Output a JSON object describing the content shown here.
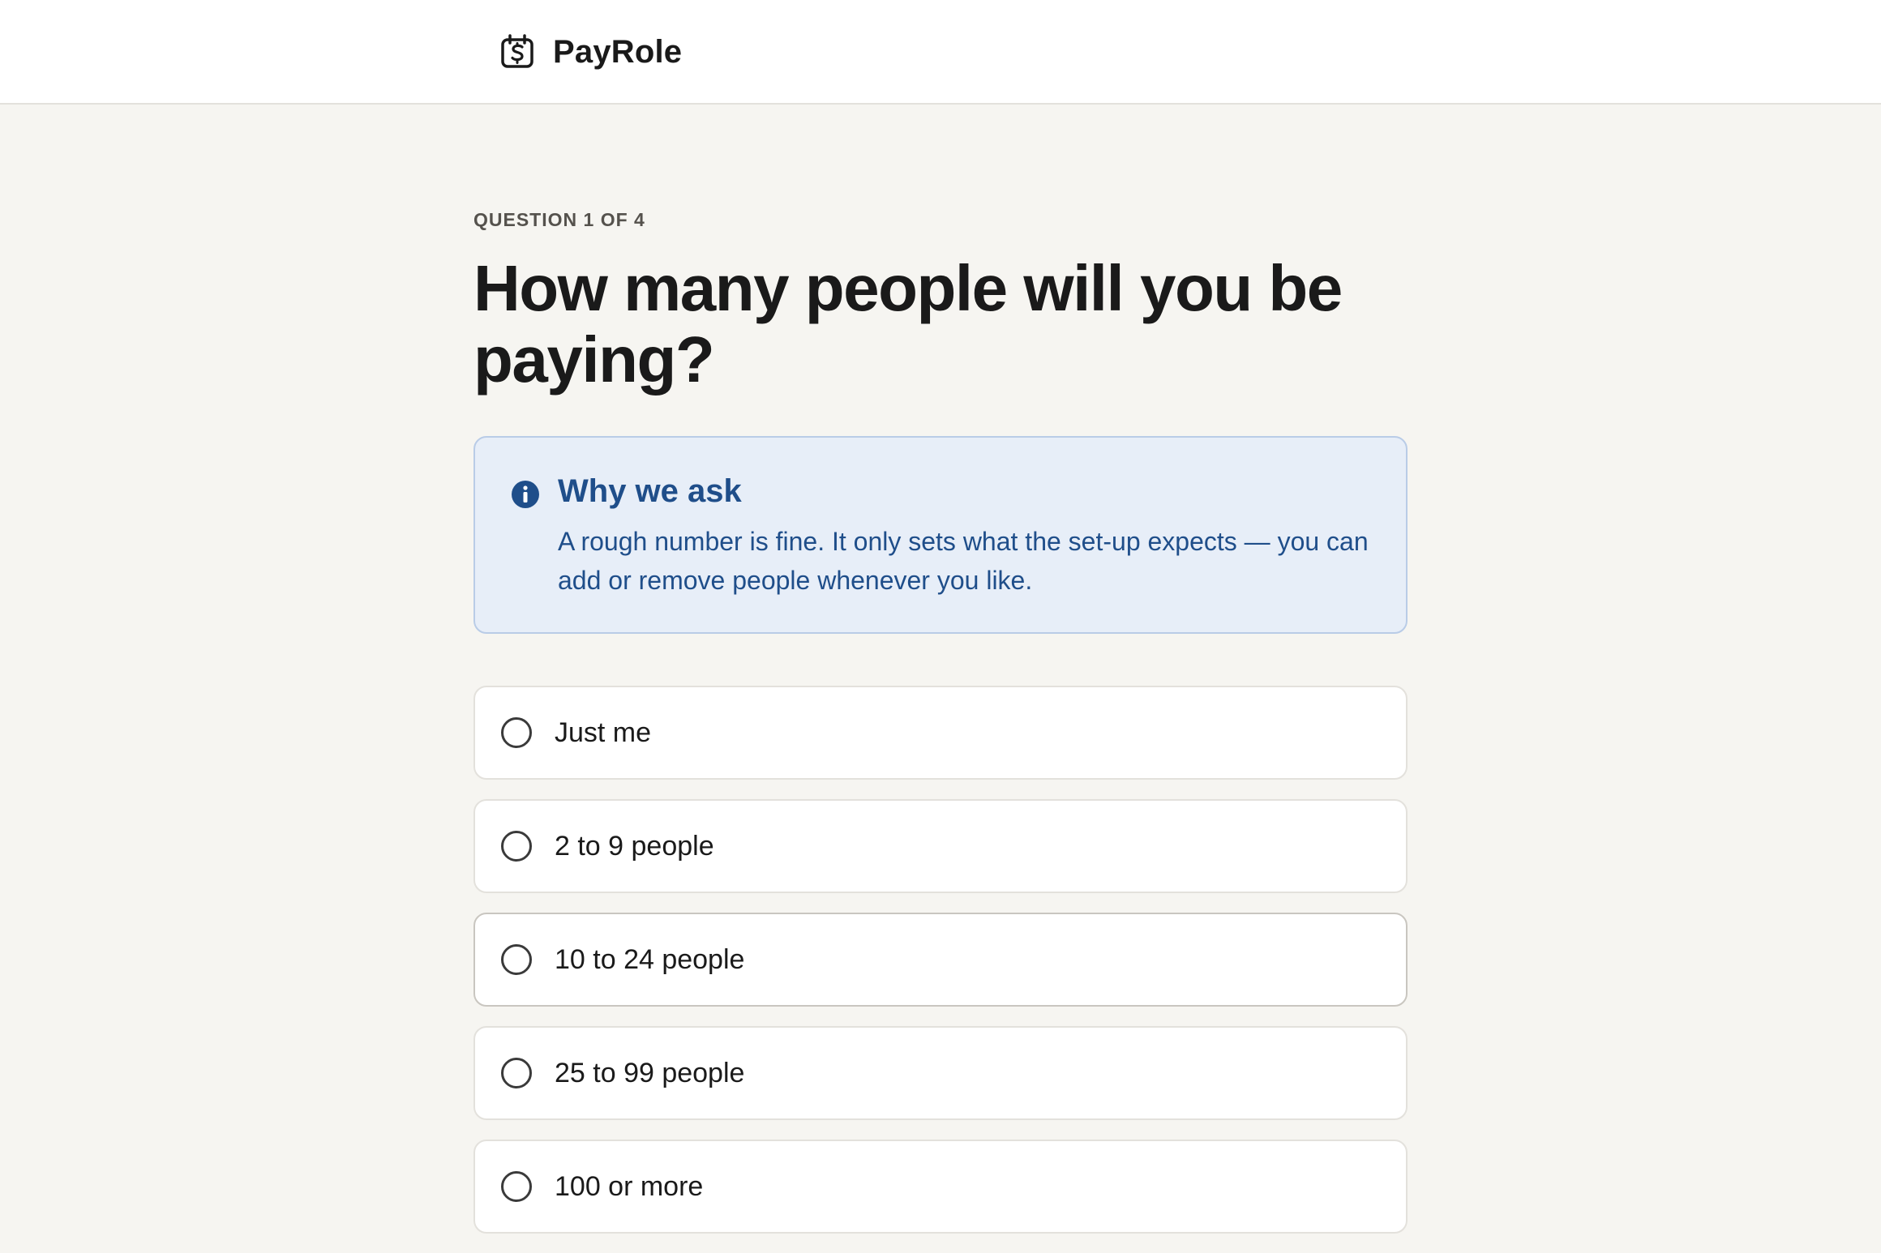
{
  "header": {
    "brand_name": "PayRole",
    "brand_icon": "calendar-dollar-icon"
  },
  "question": {
    "step_label": "QUESTION 1 OF 4",
    "title": "How many people will you be paying?"
  },
  "info": {
    "icon": "info-icon",
    "title": "Why we ask",
    "body": "A rough number is fine. It only sets what the set-up expects — you can add or remove people whenever you like.",
    "colors": {
      "background": "#e7eef8",
      "border": "#b9cce7",
      "text": "#1f4e8a"
    }
  },
  "options": [
    {
      "label": "Just me",
      "selected": false
    },
    {
      "label": "2 to 9 people",
      "selected": false
    },
    {
      "label": "10 to 24 people",
      "selected": false
    },
    {
      "label": "25 to 99 people",
      "selected": false
    },
    {
      "label": "100 or more",
      "selected": false
    }
  ]
}
